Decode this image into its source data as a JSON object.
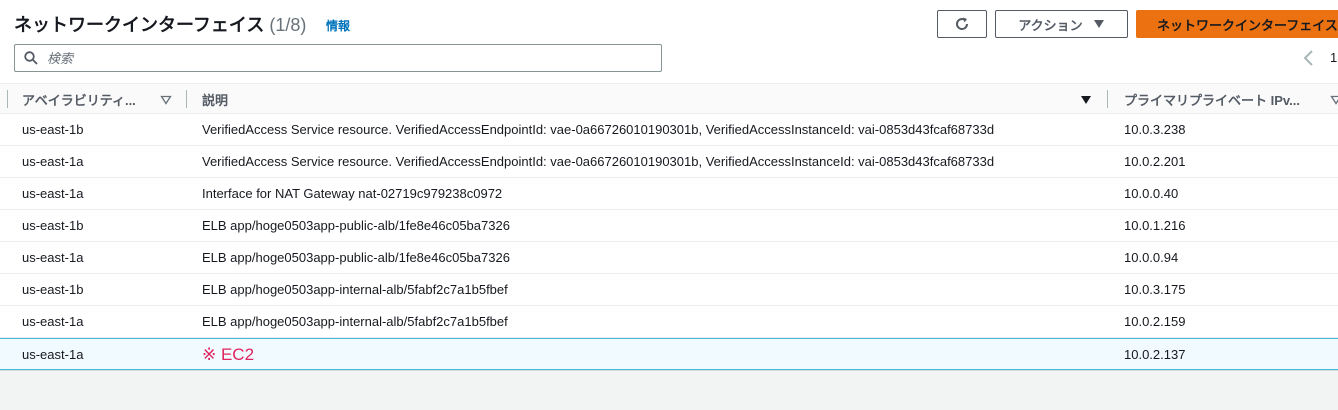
{
  "header": {
    "title": "ネットワークインターフェイス",
    "count": "(1/8)",
    "info_link": "情報",
    "actions_label": "アクション",
    "primary_label": "ネットワークインターフェイスを作成"
  },
  "search": {
    "placeholder": "検索",
    "value": ""
  },
  "pagination": {
    "current_page": "1"
  },
  "columns": [
    {
      "label": "アベイラビリティ..."
    },
    {
      "label": "説明"
    },
    {
      "label": "プライマリプライベート IPv..."
    }
  ],
  "rows": [
    {
      "az": "us-east-1b",
      "description": "VerifiedAccess Service resource. VerifiedAccessEndpointId: vae-0a66726010190301b, VerifiedAccessInstanceId: vai-0853d43fcaf68733d",
      "ip": "10.0.3.238"
    },
    {
      "az": "us-east-1a",
      "description": "VerifiedAccess Service resource. VerifiedAccessEndpointId: vae-0a66726010190301b, VerifiedAccessInstanceId: vai-0853d43fcaf68733d",
      "ip": "10.0.2.201"
    },
    {
      "az": "us-east-1a",
      "description": "Interface for NAT Gateway nat-02719c979238c0972",
      "ip": "10.0.0.40"
    },
    {
      "az": "us-east-1b",
      "description": "ELB app/hoge0503app-public-alb/1fe8e46c05ba7326",
      "ip": "10.0.1.216"
    },
    {
      "az": "us-east-1a",
      "description": "ELB app/hoge0503app-public-alb/1fe8e46c05ba7326",
      "ip": "10.0.0.94"
    },
    {
      "az": "us-east-1b",
      "description": "ELB app/hoge0503app-internal-alb/5fabf2c7a1b5fbef",
      "ip": "10.0.3.175"
    },
    {
      "az": "us-east-1a",
      "description": "ELB app/hoge0503app-internal-alb/5fabf2c7a1b5fbef",
      "ip": "10.0.2.159"
    },
    {
      "az": "us-east-1a",
      "description": "※ EC2",
      "ip": "10.0.2.137",
      "selected": true
    }
  ],
  "colors": {
    "primary": "#ec7211",
    "link": "#0073bb",
    "annotation": "#e0245e",
    "selected_row_bg": "#f1faff",
    "selected_row_border": "#44b9d6"
  },
  "icons": [
    "refresh-icon",
    "caret-down-icon",
    "search-icon",
    "chevron-left-icon",
    "sort-icon",
    "sort-filled-icon"
  ]
}
